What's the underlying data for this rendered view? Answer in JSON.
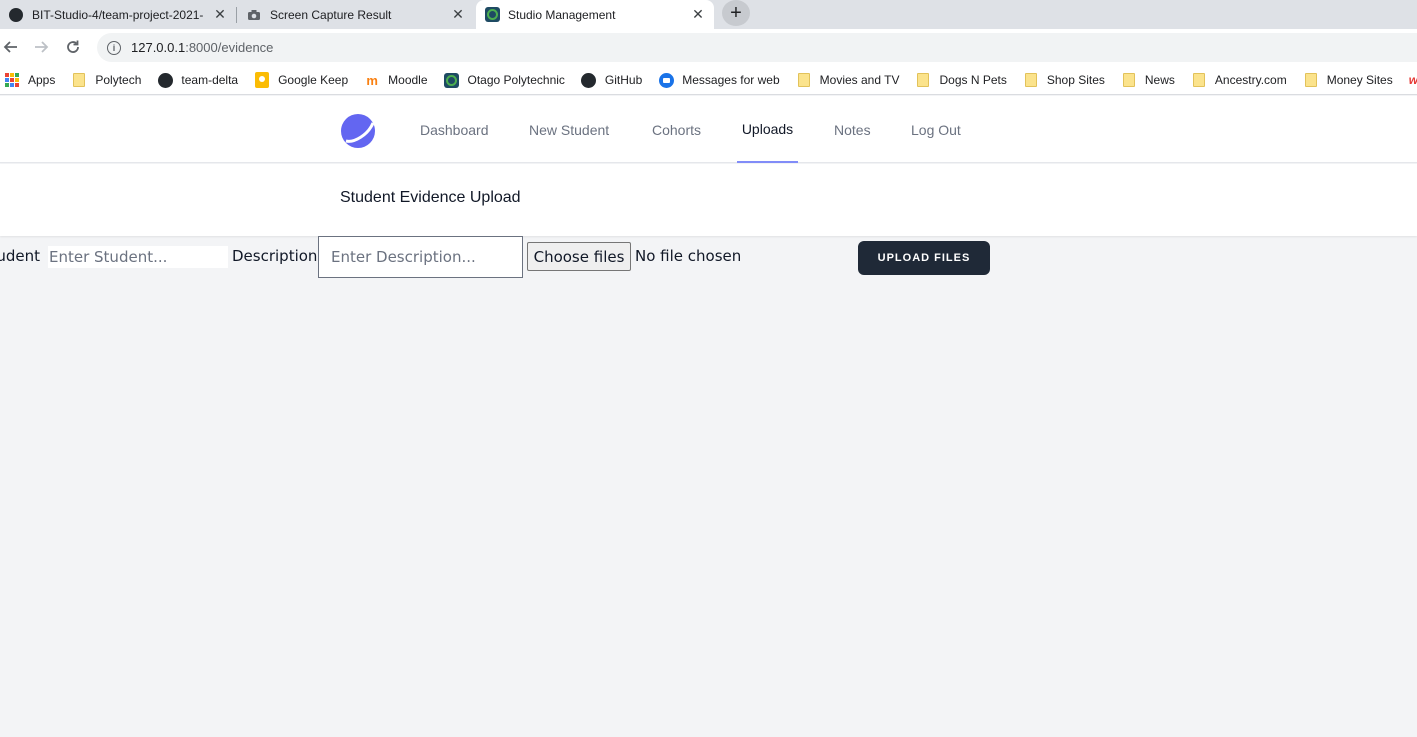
{
  "browser": {
    "tabs": [
      {
        "title": "BIT-Studio-4/team-project-2021-",
        "close": "✕"
      },
      {
        "title": "Screen Capture Result",
        "close": "✕"
      },
      {
        "title": "Studio Management",
        "close": "✕",
        "active": true
      }
    ],
    "new_tab": "+",
    "url_host": "127.0.0.1",
    "url_path": ":8000/evidence",
    "bookmarks": [
      {
        "label": "Apps",
        "icon": "apps-icon"
      },
      {
        "label": "Polytech",
        "icon": "folder-icon"
      },
      {
        "label": "team-delta",
        "icon": "github-icon"
      },
      {
        "label": "Google Keep",
        "icon": "keep-icon"
      },
      {
        "label": "Moodle",
        "icon": "moodle-icon"
      },
      {
        "label": "Otago Polytechnic",
        "icon": "otago-icon"
      },
      {
        "label": "GitHub",
        "icon": "github-icon"
      },
      {
        "label": "Messages for web",
        "icon": "messages-icon"
      },
      {
        "label": "Movies and TV",
        "icon": "folder-icon"
      },
      {
        "label": "Dogs N Pets",
        "icon": "folder-icon"
      },
      {
        "label": "Shop Sites",
        "icon": "folder-icon"
      },
      {
        "label": "News",
        "icon": "folder-icon"
      },
      {
        "label": "Ancestry.com",
        "icon": "folder-icon"
      },
      {
        "label": "Money Sites",
        "icon": "folder-icon"
      }
    ]
  },
  "nav": {
    "links": [
      "Dashboard",
      "New Student",
      "Cohorts",
      "Uploads",
      "Notes",
      "Log Out"
    ],
    "active": "Uploads",
    "accent": "#818cf8",
    "logo_color": "#6366f1"
  },
  "header": {
    "title": "Student Evidence Upload"
  },
  "form": {
    "student_label": "Student",
    "student_placeholder": "Enter Student...",
    "description_label": "Description",
    "description_placeholder": "Enter Description...",
    "choose_files": "Choose files",
    "no_file": "No file chosen",
    "upload_button": "UPLOAD FILES",
    "button_color": "#1f2937"
  }
}
